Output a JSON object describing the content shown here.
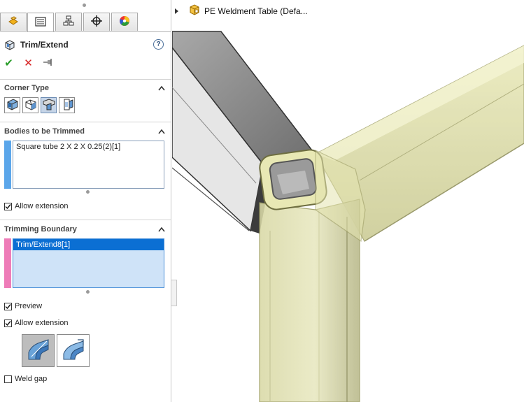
{
  "panel": {
    "title": "Trim/Extend",
    "help_label": "?",
    "tabs": [
      {
        "icon": "feature-manager-icon"
      },
      {
        "icon": "property-manager-icon"
      },
      {
        "icon": "configuration-manager-icon"
      },
      {
        "icon": "dimxpert-icon"
      },
      {
        "icon": "display-manager-icon"
      }
    ],
    "actions": {
      "ok": "✔",
      "cancel": "✕",
      "pin": "pin-icon"
    }
  },
  "corner_type": {
    "title": "Corner Type",
    "buttons": [
      "end-trim-icon",
      "end-miter-icon",
      "end-butt1-icon",
      "end-butt2-icon"
    ]
  },
  "bodies": {
    "title": "Bodies to be Trimmed",
    "items": [
      "Square tube 2 X 2 X 0.25(2)[1]"
    ],
    "allow_extension_label": "Allow extension",
    "allow_extension": true
  },
  "boundary": {
    "title": "Trimming Boundary",
    "items": [
      "Trim/Extend8[1]"
    ],
    "preview_label": "Preview",
    "preview": true,
    "allow_extension_label": "Allow extension",
    "allow_extension": true,
    "weld_gap_label": "Weld gap",
    "weld_gap": false
  },
  "tree": {
    "label": "PE Weldment Table  (Defa..."
  },
  "colors": {
    "accent": "#0b6fd3",
    "bodies_bar": "#5ba6ea",
    "boundary_bar": "#ee7cb8",
    "tube_gray": "#8c8c8c",
    "tube_yellow": "#dcdc9a"
  }
}
